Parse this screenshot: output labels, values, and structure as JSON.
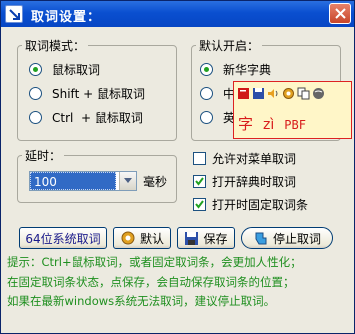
{
  "window": {
    "title": "取词设置："
  },
  "mode_group": {
    "legend": "取词模式：",
    "options": [
      {
        "label": "鼠标取词",
        "selected": true
      },
      {
        "label": "Shift + 鼠标取词",
        "selected": false
      },
      {
        "label": "Ctrl  + 鼠标取词",
        "selected": false
      }
    ]
  },
  "dict_group": {
    "legend": "默认开启：",
    "options": [
      {
        "label": "新华字典",
        "selected": true
      },
      {
        "label": "中",
        "selected": false
      },
      {
        "label": "英",
        "selected": false
      }
    ]
  },
  "delay_group": {
    "legend": "延时：",
    "value": "100",
    "unit": "毫秒"
  },
  "checkboxes": [
    {
      "label": "允许对菜单取词",
      "checked": false
    },
    {
      "label": "打开辞典时取词",
      "checked": true
    },
    {
      "label": "打开时固定取词条",
      "checked": true
    }
  ],
  "buttons": {
    "sys64": "64位系统取词",
    "default": "默认",
    "save": "保存",
    "stop": "停止取词"
  },
  "tip": {
    "line1": "提示：Ctrl+鼠标取词，或者固定取词条，会更加人性化；",
    "line2": "在固定取词条状态，点保存，会自动保存取词条的位置；",
    "line3": "如果在最新windows系统无法取词，建议停止取词。"
  },
  "popup": {
    "char": "字",
    "pinyin": "zì",
    "code": "PBF",
    "icons": [
      "book-icon",
      "floppy-icon",
      "speaker-icon",
      "settings-icon",
      "copy-icon",
      "globe-icon"
    ]
  },
  "colors": {
    "accent": "#0a4fd0",
    "tip_text": "#1f8f1f",
    "popup_text": "#d81c1c",
    "selection": "#316ac5"
  }
}
